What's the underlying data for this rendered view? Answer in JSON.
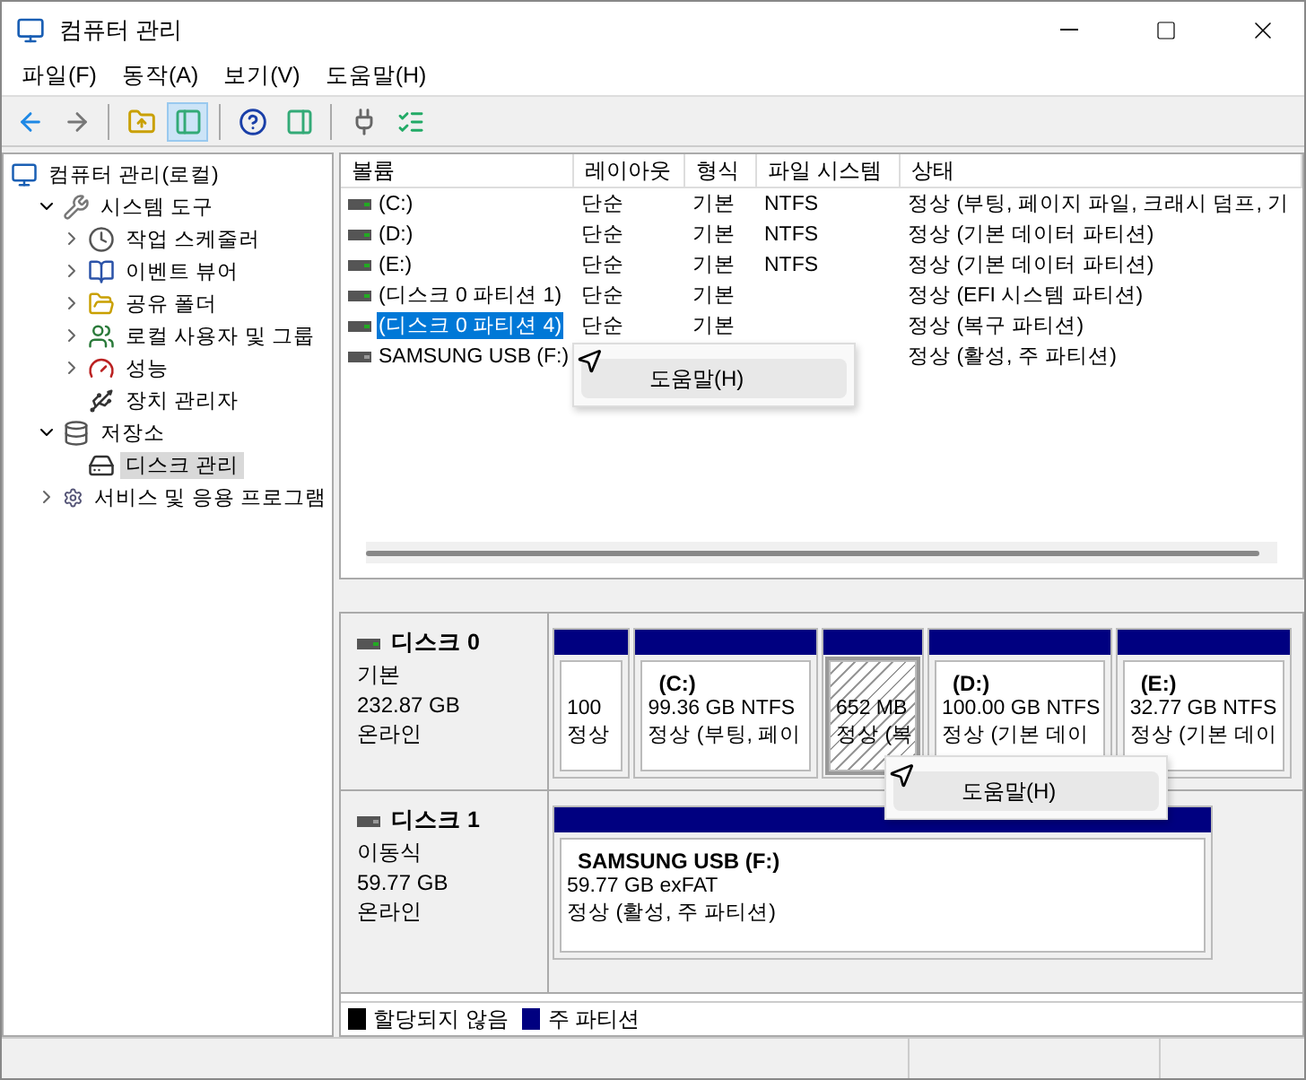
{
  "window": {
    "title": "컴퓨터 관리"
  },
  "menu": [
    "파일(F)",
    "동작(A)",
    "보기(V)",
    "도움말(H)"
  ],
  "toolbar": [
    [
      {
        "kind": "back",
        "pressed": false
      },
      {
        "kind": "forward",
        "pressed": false
      }
    ],
    [
      {
        "kind": "up",
        "pressed": false
      },
      {
        "kind": "tree",
        "pressed": true
      }
    ],
    [
      {
        "kind": "help",
        "pressed": false
      },
      {
        "kind": "pane",
        "pressed": false
      }
    ],
    [
      {
        "kind": "connect",
        "pressed": false
      },
      {
        "kind": "props",
        "pressed": false
      }
    ]
  ],
  "tree": [
    {
      "label": "컴퓨터 관리(로컬)",
      "kind": "computer",
      "selected": false,
      "children": [
        {
          "label": "시스템 도구",
          "kind": "tools",
          "expanded": true,
          "selected": false,
          "children": [
            {
              "label": "작업 스케줄러",
              "kind": "clock",
              "expanded": false,
              "selected": false
            },
            {
              "label": "이벤트 뷰어",
              "kind": "book",
              "expanded": false,
              "selected": false
            },
            {
              "label": "공유 폴더",
              "kind": "folder",
              "expanded": false,
              "selected": false
            },
            {
              "label": "로컬 사용자 및 그룹",
              "kind": "users",
              "expanded": false,
              "selected": false
            },
            {
              "label": "성능",
              "kind": "gauge",
              "expanded": false,
              "selected": false
            },
            {
              "label": "장치 관리자",
              "kind": "device",
              "selected": false
            }
          ]
        },
        {
          "label": "저장소",
          "kind": "storage",
          "expanded": true,
          "selected": false,
          "children": [
            {
              "label": "디스크 관리",
              "kind": "disk",
              "selected": true
            }
          ]
        },
        {
          "label": "서비스 및 응용 프로그램",
          "kind": "services",
          "expanded": false,
          "selected": false
        }
      ]
    }
  ],
  "volume_table": {
    "columns": [
      "볼륨",
      "레이아웃",
      "형식",
      "파일 시스템",
      "상태"
    ],
    "rows": [
      {
        "cells": [
          "(C:)",
          "단순",
          "기본",
          "NTFS",
          "정상 (부팅, 페이지 파일, 크래시 덤프, 기"
        ],
        "selected": false
      },
      {
        "cells": [
          "(D:)",
          "단순",
          "기본",
          "NTFS",
          "정상 (기본 데이터 파티션)"
        ],
        "selected": false
      },
      {
        "cells": [
          "(E:)",
          "단순",
          "기본",
          "NTFS",
          "정상 (기본 데이터 파티션)"
        ],
        "selected": false
      },
      {
        "cells": [
          "(디스크 0 파티션 1)",
          "단순",
          "기본",
          "",
          "정상 (EFI 시스템 파티션)"
        ],
        "selected": false
      },
      {
        "cells": [
          "(디스크 0 파티션 4)",
          "단순",
          "기본",
          "",
          "정상 (복구 파티션)"
        ],
        "selected": true
      },
      {
        "cells": [
          "SAMSUNG USB (F:)",
          "",
          "",
          "",
          "정상 (활성, 주 파티션)"
        ],
        "selected": false
      }
    ]
  },
  "disks": [
    {
      "name": "디스크 0",
      "type": "기본",
      "size": "232.87 GB",
      "status": "온라인",
      "partitions": [
        {
          "size_fs": "100",
          "status": "정상",
          "selected": false
        },
        {
          "label": "(C:)",
          "size_fs": "99.36 GB NTFS",
          "status": "정상 (부팅, 페이",
          "selected": false
        },
        {
          "size_fs": "652 MB",
          "status": "정상 (복",
          "selected": true
        },
        {
          "label": "(D:)",
          "size_fs": "100.00 GB NTFS",
          "status": "정상 (기본 데이",
          "selected": false
        },
        {
          "label": "(E:)",
          "size_fs": "32.77 GB NTFS",
          "status": "정상 (기본 데이",
          "selected": false
        }
      ]
    },
    {
      "name": "디스크 1",
      "type": "이동식",
      "size": "59.77 GB",
      "status": "온라인",
      "partitions": [
        {
          "label": "SAMSUNG USB  (F:)",
          "size_fs": "59.77 GB exFAT",
          "status": "정상 (활성, 주 파티션)",
          "selected": false
        }
      ]
    }
  ],
  "legend": [
    {
      "label": "할당되지 않음",
      "color": "#000000"
    },
    {
      "label": "주 파티션",
      "color": "#000080"
    }
  ],
  "context_menus": [
    {
      "items": [
        "도움말(H)"
      ]
    },
    {
      "items": [
        "도움말(H)"
      ]
    }
  ]
}
